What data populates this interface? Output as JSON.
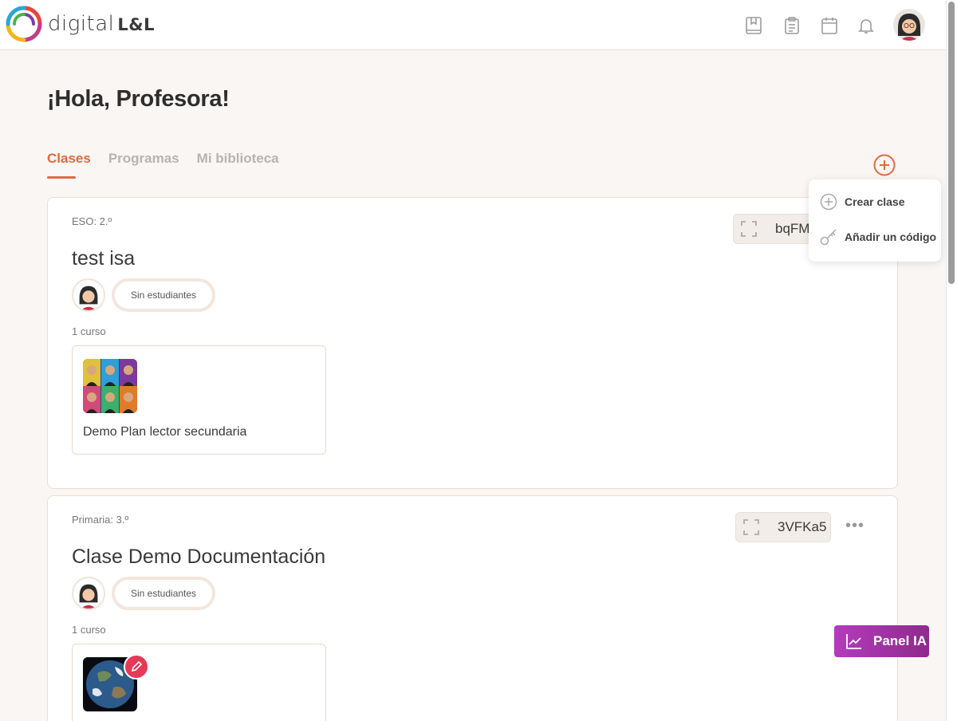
{
  "header": {
    "logo_text": "digital",
    "logo_suffix": "L&L",
    "icons": [
      "bookmark-book-icon",
      "clipboard-icon",
      "calendar-icon",
      "bell-icon"
    ],
    "avatar": "user-avatar"
  },
  "greeting": "¡Hola, Profesora!",
  "tabs": [
    {
      "label": "Clases",
      "active": true
    },
    {
      "label": "Programas",
      "active": false
    },
    {
      "label": "Mi biblioteca",
      "active": false
    }
  ],
  "dropdown": {
    "items": [
      {
        "label": "Crear clase",
        "icon": "plus-circle-icon"
      },
      {
        "label": "Añadir un código",
        "icon": "key-icon"
      }
    ]
  },
  "classes": [
    {
      "level": "ESO: 2.º",
      "title": "test isa",
      "code": "bqFM",
      "students": "Sin estudiantes",
      "course_count": "1 curso",
      "course_name": "Demo Plan lector secundaria"
    },
    {
      "level": "Primaria: 3.º",
      "title": "Clase Demo Documentación",
      "code": "3VFKa5",
      "students": "Sin estudiantes",
      "course_count": "1 curso",
      "course_name": ""
    }
  ],
  "panel_ia": {
    "label": "Panel IA"
  },
  "colors": {
    "accent": "#e06a3e",
    "panel_ia": "#a834ab",
    "edit_badge": "#e53958",
    "background": "#faf6f3"
  }
}
